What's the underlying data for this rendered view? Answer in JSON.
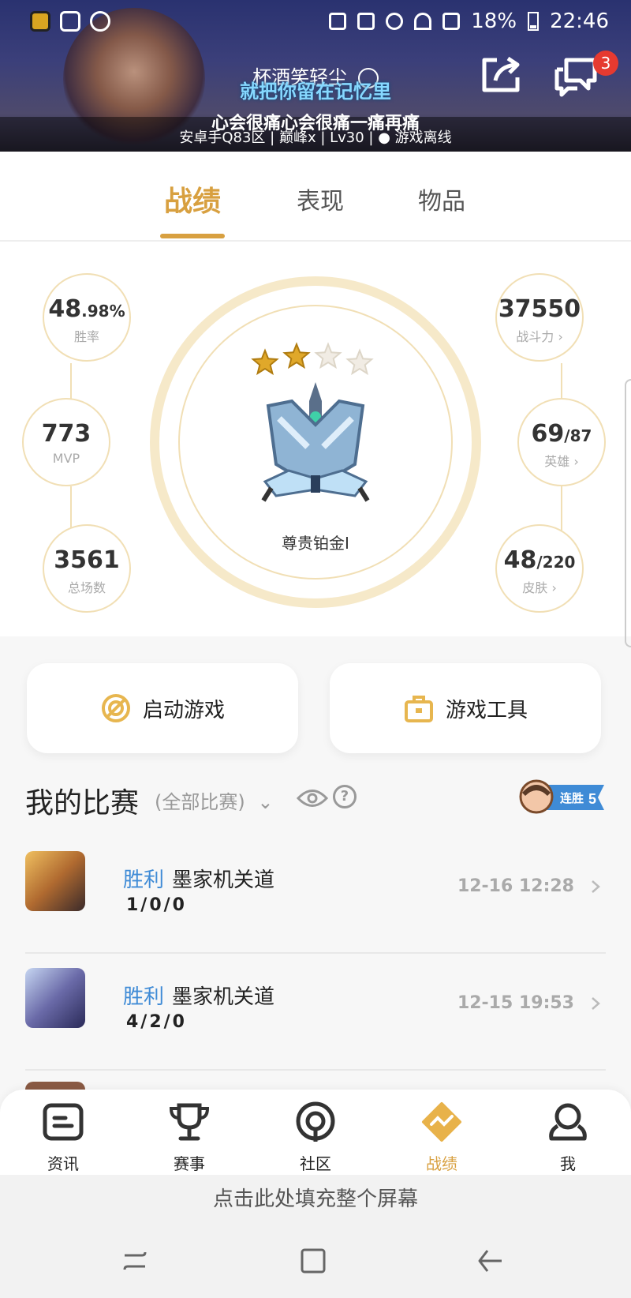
{
  "status_bar": {
    "battery": "18%",
    "time": "22:46"
  },
  "profile": {
    "nickname": "杯酒笑轻尘",
    "motto_overlay": "就把你留在记忆里",
    "signature": "心会很痛心会很痛一痛再痛",
    "details": "安卓手Q83区 | 巅峰x | Lv30 | ● 游戏离线",
    "message_badge": "3"
  },
  "tabs": [
    "战绩",
    "表现",
    "物品"
  ],
  "stats": {
    "win_rate": {
      "value": "48",
      "frac": ".98%",
      "label": "胜率"
    },
    "mvp": {
      "value": "773",
      "label": "MVP"
    },
    "total_games": {
      "value": "3561",
      "label": "总场数"
    },
    "power": {
      "value": "37550",
      "label": "战斗力 ›"
    },
    "heroes": {
      "value": "69",
      "frac": "/87",
      "label": "英雄 ›"
    },
    "skins": {
      "value": "48",
      "frac": "/220",
      "label": "皮肤 ›"
    }
  },
  "rank": {
    "name": "尊贵铂金I",
    "stars_filled": 2,
    "stars_total": 4
  },
  "buttons": {
    "launch": "启动游戏",
    "tools": "游戏工具"
  },
  "matches_section": {
    "title": "我的比赛",
    "filter": "(全部比赛)",
    "streak_label": "连胜",
    "streak_count": "5"
  },
  "matches": [
    {
      "result": "胜利",
      "map": "墨家机关道",
      "kda": "1/0/0",
      "time": "12-16 12:28"
    },
    {
      "result": "胜利",
      "map": "墨家机关道",
      "kda": "4/2/0",
      "time": "12-15 19:53"
    }
  ],
  "bottom_nav": [
    "资讯",
    "赛事",
    "社区",
    "战绩",
    "我"
  ],
  "fill_screen": "点击此处填充整个屏幕",
  "colors": {
    "accent": "#d8a040",
    "win": "#3f8bd6",
    "badge": "#e63a30"
  }
}
